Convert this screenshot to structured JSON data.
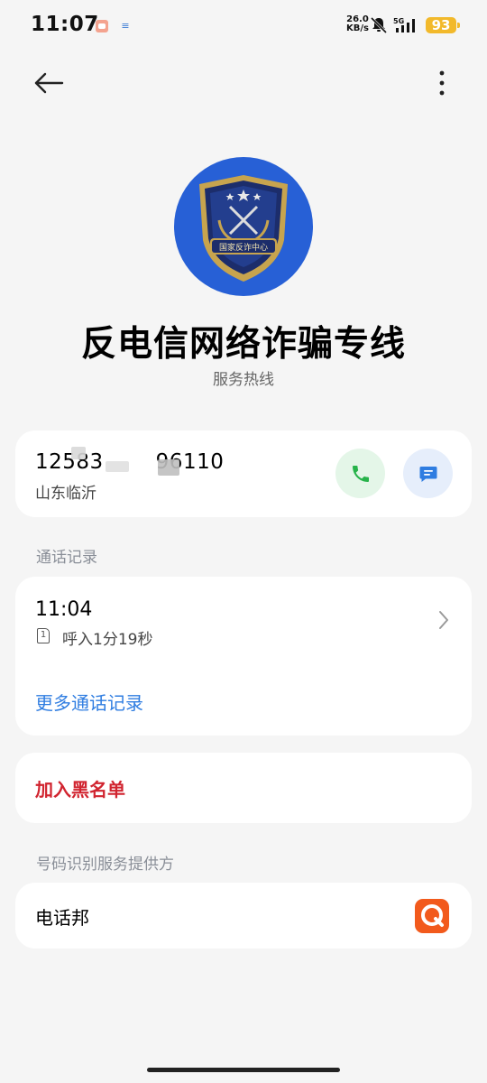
{
  "status_bar": {
    "time": "11:07",
    "net_speed_value": "26.0",
    "net_speed_unit": "KB/s",
    "network": "5G",
    "battery": "93"
  },
  "contact": {
    "name": "反电信网络诈骗专线",
    "subtitle": "服务热线",
    "avatar_badge_text": "国家反诈中心"
  },
  "number_card": {
    "number_start": "12583",
    "number_end": "96110",
    "location": "山东临沂"
  },
  "history": {
    "section_title": "通话记录",
    "entries": [
      {
        "time": "11:04",
        "sim": "1",
        "detail": "呼入1分19秒"
      }
    ],
    "more_link": "更多通话记录"
  },
  "block": {
    "label": "加入黑名单"
  },
  "provider": {
    "section_title": "号码识别服务提供方",
    "name": "电话邦"
  },
  "colors": {
    "accent_blue": "#2f7de1",
    "danger_red": "#d1242f",
    "call_green": "#27b34a",
    "battery_yellow": "#f2b92b",
    "provider_orange": "#f25a1c"
  }
}
